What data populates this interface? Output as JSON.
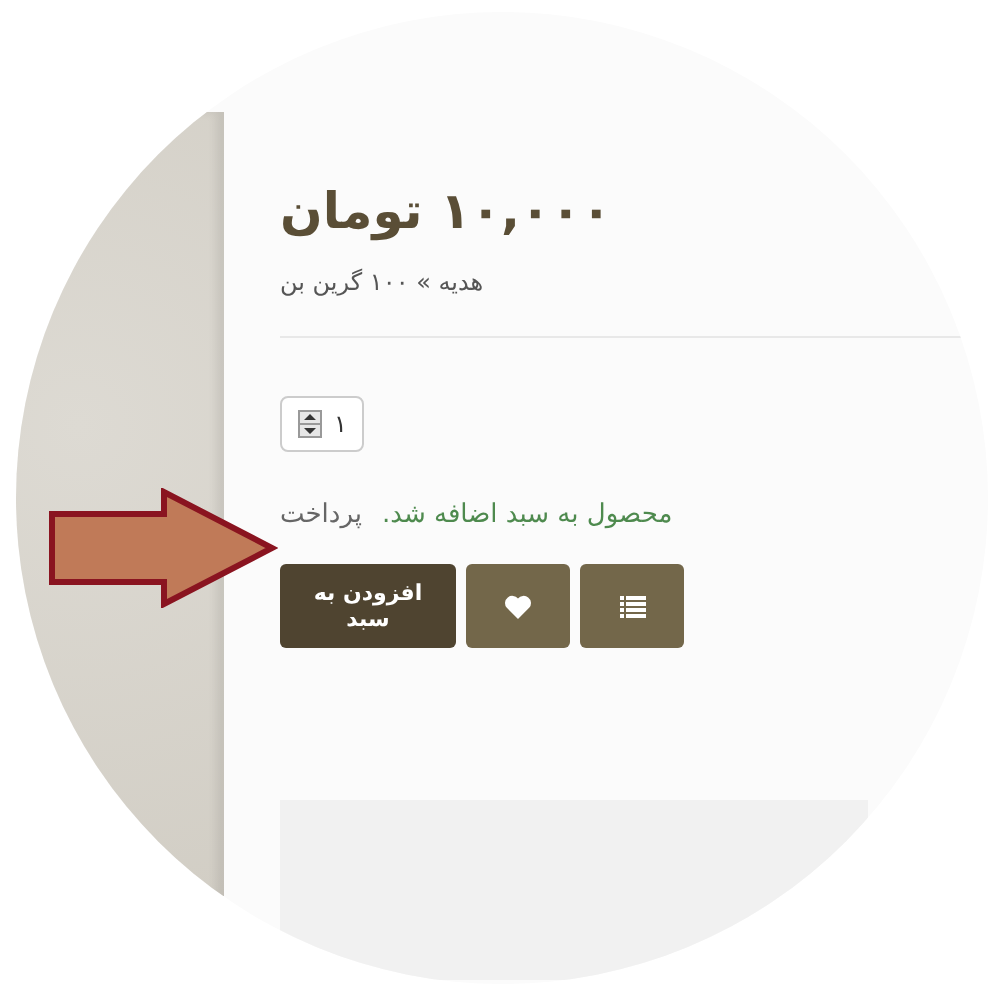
{
  "price": "۱۰,۰۰۰ تومان",
  "breadcrumb": "هدیه » ۱۰۰ گرین بن",
  "quantity": {
    "value": "۱"
  },
  "notice": {
    "message": "محصول به سبد اضافه شد.",
    "link": "پرداخت"
  },
  "buttons": [
    {
      "kind": "cart",
      "label": "افزودن به سبد"
    },
    {
      "kind": "wishlist"
    },
    {
      "kind": "compare"
    }
  ]
}
